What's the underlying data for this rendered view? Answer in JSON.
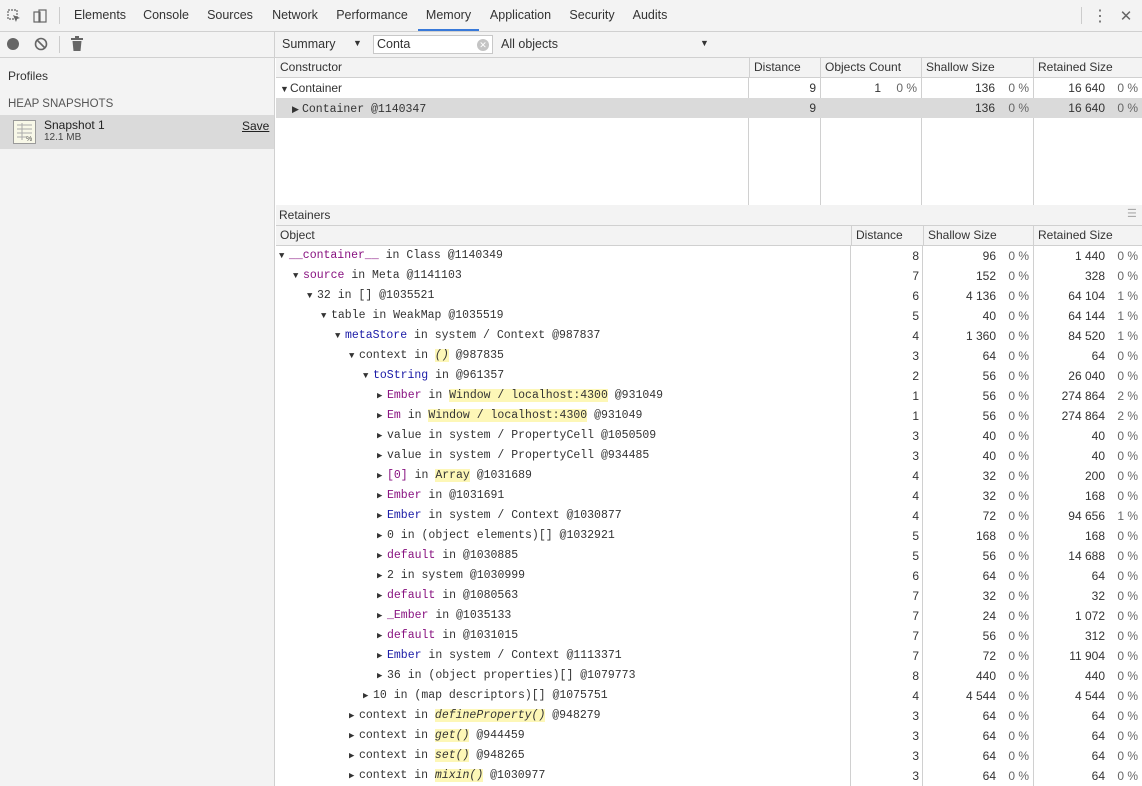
{
  "tabs": [
    "Elements",
    "Console",
    "Sources",
    "Network",
    "Performance",
    "Memory",
    "Application",
    "Security",
    "Audits"
  ],
  "active_tab": "Memory",
  "sidebar": {
    "title": "Profiles",
    "section": "HEAP SNAPSHOTS",
    "snapshot": {
      "name": "Snapshot 1",
      "size": "12.1 MB",
      "save": "Save"
    }
  },
  "toolbar": {
    "view": "Summary",
    "filter": "Conta",
    "objects": "All objects"
  },
  "constructors": {
    "headers": [
      "Constructor",
      "Distance",
      "Objects Count",
      "Shallow Size",
      "Retained Size"
    ],
    "rows": [
      {
        "label": "Container",
        "id": "",
        "distance": "9",
        "count": "1",
        "count_pct": "0 %",
        "shallow": "136",
        "shallow_pct": "0 %",
        "retained": "16 640",
        "retained_pct": "0 %",
        "expanded": true
      },
      {
        "label": "Container",
        "id": "@1140347",
        "distance": "9",
        "count": "",
        "count_pct": "",
        "shallow": "136",
        "shallow_pct": "0 %",
        "retained": "16 640",
        "retained_pct": "0 %",
        "expanded": false
      }
    ]
  },
  "retainers": {
    "title": "Retainers",
    "headers": [
      "Object",
      "Distance",
      "Shallow Size",
      "Retained Size"
    ],
    "rows": [
      {
        "indent": 0,
        "open": true,
        "name": "__container__",
        "nc": "purple",
        "mid": "in",
        "ctx": "Class",
        "id": "@1140349",
        "d": "8",
        "s": "96",
        "sp": "0 %",
        "r": "1 440",
        "rp": "0 %"
      },
      {
        "indent": 1,
        "open": true,
        "name": "source",
        "nc": "purple",
        "mid": "in",
        "ctx": "Meta",
        "id": "@1141103",
        "d": "7",
        "s": "152",
        "sp": "0 %",
        "r": "328",
        "rp": "0 %"
      },
      {
        "indent": 2,
        "open": true,
        "name": "32",
        "nc": "",
        "mid": "in",
        "ctx": "[]",
        "id": "@1035521",
        "d": "6",
        "s": "4 136",
        "sp": "0 %",
        "r": "64 104",
        "rp": "1 %"
      },
      {
        "indent": 3,
        "open": true,
        "name": "table",
        "nc": "",
        "mid": "in",
        "ctx": "WeakMap",
        "id": "@1035519",
        "d": "5",
        "s": "40",
        "sp": "0 %",
        "r": "64 144",
        "rp": "1 %"
      },
      {
        "indent": 4,
        "open": true,
        "name": "metaStore",
        "nc": "blue",
        "mid": "in",
        "ctx": "system / Context",
        "id": "@987837",
        "d": "4",
        "s": "1 360",
        "sp": "0 %",
        "r": "84 520",
        "rp": "1 %"
      },
      {
        "indent": 5,
        "open": true,
        "name": "context",
        "nc": "",
        "mid": "in",
        "ctx": "()",
        "cc": "hl it",
        "id": "@987835",
        "d": "3",
        "s": "64",
        "sp": "0 %",
        "r": "64",
        "rp": "0 %"
      },
      {
        "indent": 6,
        "open": true,
        "name": "toString",
        "nc": "blue",
        "mid": "in",
        "ctx": "",
        "id": "@961357",
        "d": "2",
        "s": "56",
        "sp": "0 %",
        "r": "26 040",
        "rp": "0 %"
      },
      {
        "indent": 7,
        "open": false,
        "name": "Ember",
        "nc": "purple",
        "mid": "in",
        "ctx": "Window / localhost:4300",
        "cc": "hl",
        "id": "@931049",
        "d": "1",
        "s": "56",
        "sp": "0 %",
        "r": "274 864",
        "rp": "2 %"
      },
      {
        "indent": 7,
        "open": false,
        "name": "Em",
        "nc": "purple",
        "mid": "in",
        "ctx": "Window / localhost:4300",
        "cc": "hl",
        "id": "@931049",
        "d": "1",
        "s": "56",
        "sp": "0 %",
        "r": "274 864",
        "rp": "2 %"
      },
      {
        "indent": 7,
        "open": false,
        "name": "value",
        "nc": "",
        "mid": "in",
        "ctx": "system / PropertyCell",
        "id": "@1050509",
        "d": "3",
        "s": "40",
        "sp": "0 %",
        "r": "40",
        "rp": "0 %"
      },
      {
        "indent": 7,
        "open": false,
        "name": "value",
        "nc": "",
        "mid": "in",
        "ctx": "system / PropertyCell",
        "id": "@934485",
        "d": "3",
        "s": "40",
        "sp": "0 %",
        "r": "40",
        "rp": "0 %"
      },
      {
        "indent": 7,
        "open": false,
        "name": "[0]",
        "nc": "purple",
        "mid": "in",
        "ctx": "Array",
        "cc": "hl",
        "id": "@1031689",
        "d": "4",
        "s": "32",
        "sp": "0 %",
        "r": "200",
        "rp": "0 %"
      },
      {
        "indent": 7,
        "open": false,
        "name": "Ember",
        "nc": "purple",
        "mid": "in",
        "ctx": "",
        "id": "@1031691",
        "d": "4",
        "s": "32",
        "sp": "0 %",
        "r": "168",
        "rp": "0 %"
      },
      {
        "indent": 7,
        "open": false,
        "name": "Ember",
        "nc": "blue",
        "mid": "in",
        "ctx": "system / Context",
        "id": "@1030877",
        "d": "4",
        "s": "72",
        "sp": "0 %",
        "r": "94 656",
        "rp": "1 %"
      },
      {
        "indent": 7,
        "open": false,
        "name": "0",
        "nc": "",
        "mid": "in",
        "ctx": "(object elements)[]",
        "id": "@1032921",
        "d": "5",
        "s": "168",
        "sp": "0 %",
        "r": "168",
        "rp": "0 %"
      },
      {
        "indent": 7,
        "open": false,
        "name": "default",
        "nc": "purple",
        "mid": "in",
        "ctx": "",
        "id": "@1030885",
        "d": "5",
        "s": "56",
        "sp": "0 %",
        "r": "14 688",
        "rp": "0 %"
      },
      {
        "indent": 7,
        "open": false,
        "name": "2",
        "nc": "",
        "mid": "in",
        "ctx": "system",
        "id": "@1030999",
        "d": "6",
        "s": "64",
        "sp": "0 %",
        "r": "64",
        "rp": "0 %"
      },
      {
        "indent": 7,
        "open": false,
        "name": "default",
        "nc": "purple",
        "mid": "in",
        "ctx": "",
        "id": "@1080563",
        "d": "7",
        "s": "32",
        "sp": "0 %",
        "r": "32",
        "rp": "0 %"
      },
      {
        "indent": 7,
        "open": false,
        "name": "_Ember",
        "nc": "purple",
        "mid": "in",
        "ctx": "",
        "id": "@1035133",
        "d": "7",
        "s": "24",
        "sp": "0 %",
        "r": "1 072",
        "rp": "0 %"
      },
      {
        "indent": 7,
        "open": false,
        "name": "default",
        "nc": "purple",
        "mid": "in",
        "ctx": "",
        "id": "@1031015",
        "d": "7",
        "s": "56",
        "sp": "0 %",
        "r": "312",
        "rp": "0 %"
      },
      {
        "indent": 7,
        "open": false,
        "name": "Ember",
        "nc": "blue",
        "mid": "in",
        "ctx": "system / Context",
        "id": "@1113371",
        "d": "7",
        "s": "72",
        "sp": "0 %",
        "r": "11 904",
        "rp": "0 %"
      },
      {
        "indent": 7,
        "open": false,
        "name": "36",
        "nc": "",
        "mid": "in",
        "ctx": "(object properties)[]",
        "id": "@1079773",
        "d": "8",
        "s": "440",
        "sp": "0 %",
        "r": "440",
        "rp": "0 %"
      },
      {
        "indent": 6,
        "open": false,
        "name": "10",
        "nc": "",
        "mid": "in",
        "ctx": "(map descriptors)[]",
        "id": "@1075751",
        "d": "4",
        "s": "4 544",
        "sp": "0 %",
        "r": "4 544",
        "rp": "0 %"
      },
      {
        "indent": 5,
        "open": false,
        "name": "context",
        "nc": "",
        "mid": "in",
        "ctx": "defineProperty()",
        "cc": "hl it",
        "id": "@948279",
        "d": "3",
        "s": "64",
        "sp": "0 %",
        "r": "64",
        "rp": "0 %"
      },
      {
        "indent": 5,
        "open": false,
        "name": "context",
        "nc": "",
        "mid": "in",
        "ctx": "get()",
        "cc": "hl it",
        "id": "@944459",
        "d": "3",
        "s": "64",
        "sp": "0 %",
        "r": "64",
        "rp": "0 %"
      },
      {
        "indent": 5,
        "open": false,
        "name": "context",
        "nc": "",
        "mid": "in",
        "ctx": "set()",
        "cc": "hl it",
        "id": "@948265",
        "d": "3",
        "s": "64",
        "sp": "0 %",
        "r": "64",
        "rp": "0 %"
      },
      {
        "indent": 5,
        "open": false,
        "name": "context",
        "nc": "",
        "mid": "in",
        "ctx": "mixin()",
        "cc": "hl it",
        "id": "@1030977",
        "d": "3",
        "s": "64",
        "sp": "0 %",
        "r": "64",
        "rp": "0 %"
      }
    ]
  }
}
